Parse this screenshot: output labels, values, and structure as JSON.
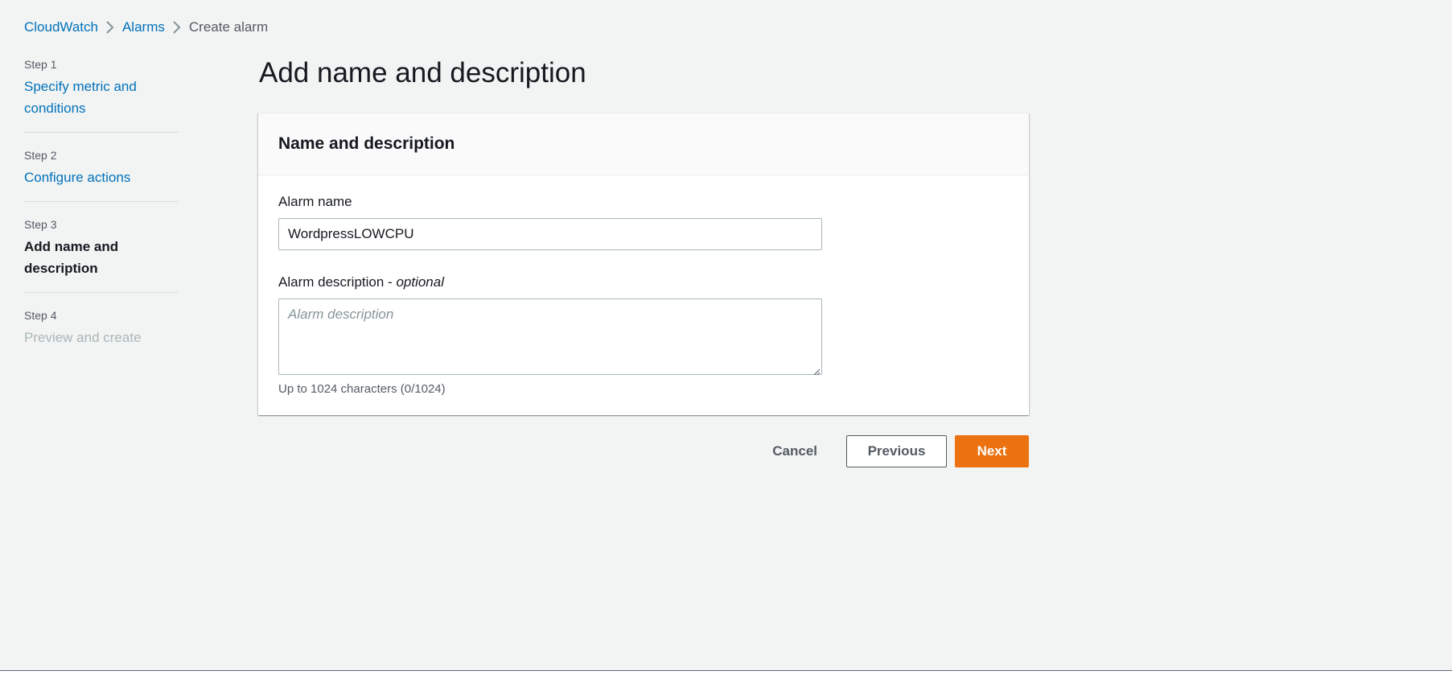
{
  "breadcrumb": {
    "items": [
      {
        "label": "CloudWatch"
      },
      {
        "label": "Alarms"
      },
      {
        "label": "Create alarm"
      }
    ]
  },
  "steps": [
    {
      "number": "Step 1",
      "title": "Specify metric and conditions",
      "state": "link"
    },
    {
      "number": "Step 2",
      "title": "Configure actions",
      "state": "link"
    },
    {
      "number": "Step 3",
      "title": "Add name and description",
      "state": "active"
    },
    {
      "number": "Step 4",
      "title": "Preview and create",
      "state": "disabled"
    }
  ],
  "page": {
    "title": "Add name and description"
  },
  "panel": {
    "title": "Name and description",
    "alarm_name": {
      "label": "Alarm name",
      "value": "WordpressLOWCPU"
    },
    "alarm_description": {
      "label": "Alarm description - ",
      "label_suffix": "optional",
      "placeholder": "Alarm description",
      "hint": "Up to 1024 characters (0/1024)"
    }
  },
  "actions": {
    "cancel": "Cancel",
    "previous": "Previous",
    "next": "Next"
  },
  "colors": {
    "link": "#0073bb",
    "primary": "#ec7211",
    "background": "#f2f3f3"
  }
}
